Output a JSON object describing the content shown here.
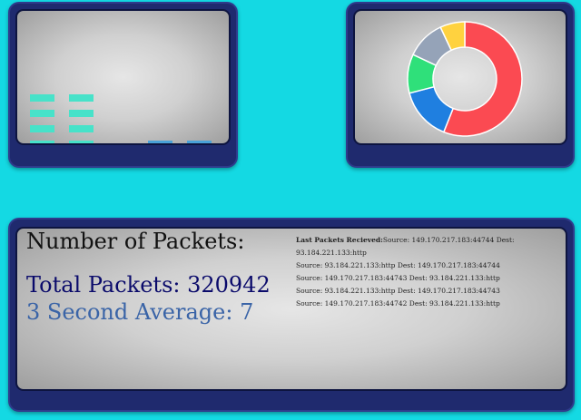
{
  "packets": {
    "heading": "Number of Packets:",
    "total": "Total Packets: 320942",
    "average": "3 Second Average: 7"
  },
  "log": {
    "label": "Last Packets Recieved:",
    "entries": [
      "Source: 149.170.217.183:44744 Dest: 93.184.221.133:http",
      "Source: 93.184.221.133:http Dest: 149.170.217.183:44744",
      "Source: 149.170.217.183:44743 Dest: 93.184.221.133:http",
      "Source: 93.184.221.133:http Dest: 149.170.217.183:44743",
      "Source: 149.170.217.183:44742 Dest: 93.184.221.133:http"
    ]
  },
  "charts": {
    "bars": {
      "teal_color": "#47e2c9",
      "blue_color": "#4aa2d8",
      "stacks": [
        {
          "color": "teal",
          "segments": 4
        },
        {
          "color": "teal",
          "segments": 4
        },
        {
          "color": "blue",
          "segments": 1
        },
        {
          "color": "blue",
          "segments": 1
        }
      ]
    },
    "donut": {
      "slices": [
        {
          "value": 56,
          "color": "#fb4a52"
        },
        {
          "value": 15,
          "color": "#1f7fe0"
        },
        {
          "value": 11,
          "color": "#2fe07a"
        },
        {
          "value": 11,
          "color": "#95a3b8"
        },
        {
          "value": 7,
          "color": "#ffd23f"
        }
      ]
    }
  }
}
